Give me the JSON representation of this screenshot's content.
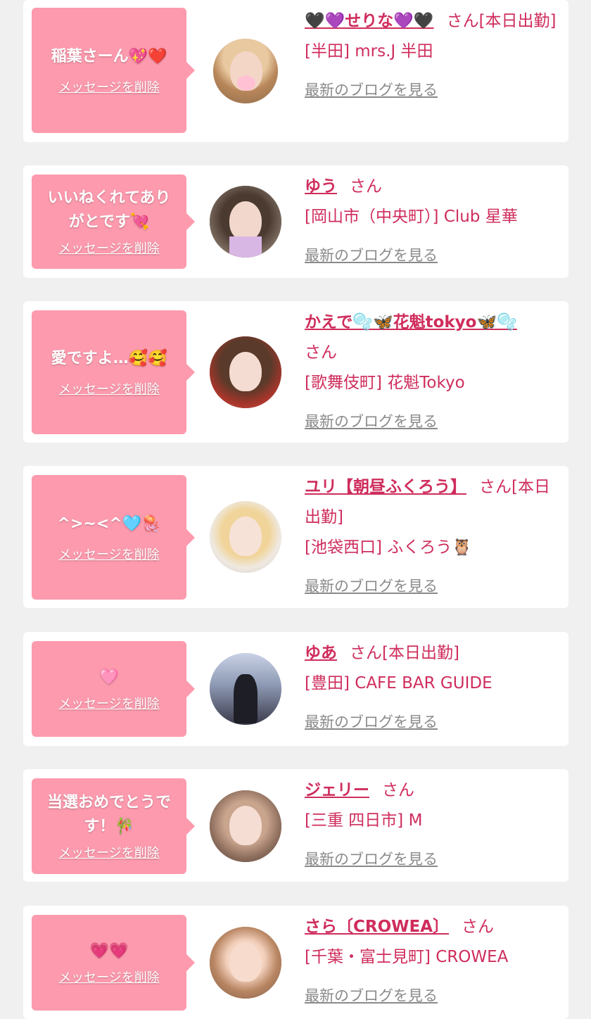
{
  "delete_label": "メッセージを削除",
  "blog_label": "最新のブログを見る",
  "colors": {
    "background": "#f0f0f0",
    "card": "#ffffff",
    "bubble": "#fd9aae",
    "name": "#cf2d5c",
    "blog_link": "#8a8a8a"
  },
  "items": [
    {
      "message": "稲葉さーん💖❤️",
      "name": "🖤💜せりな💜🖤",
      "suffix": "さん[本日出勤]",
      "shop": "[半田] mrs.J 半田"
    },
    {
      "message": "いいねくれてありがとです💘",
      "name": "ゆう",
      "suffix": "さん",
      "shop": "[岡山市（中央町）] Club 星華"
    },
    {
      "message": "愛ですよ…🥰🥰",
      "name": "かえで🫧🦋花魁tokyo🦋🫧",
      "suffix": "さん",
      "shop": "[歌舞伎町] 花魁Tokyo"
    },
    {
      "message": "^>~<^🩵🪼",
      "name": "ユリ【朝昼ふくろう】",
      "suffix": "さん[本日出勤]",
      "shop": "[池袋西口] ふくろう🦉"
    },
    {
      "message": "🩷",
      "name": "ゆあ",
      "suffix": "さん[本日出勤]",
      "shop": "[豊田] CAFE BAR GUIDE"
    },
    {
      "message": "当選おめでとうです！🎋",
      "name": "ジェリー",
      "suffix": "さん",
      "shop": "[三重 四日市] M"
    },
    {
      "message": "💗💗",
      "name": "さら〔CROWEA〕",
      "suffix": "さん",
      "shop": "[千葉・富士見町] CROWEA"
    }
  ]
}
